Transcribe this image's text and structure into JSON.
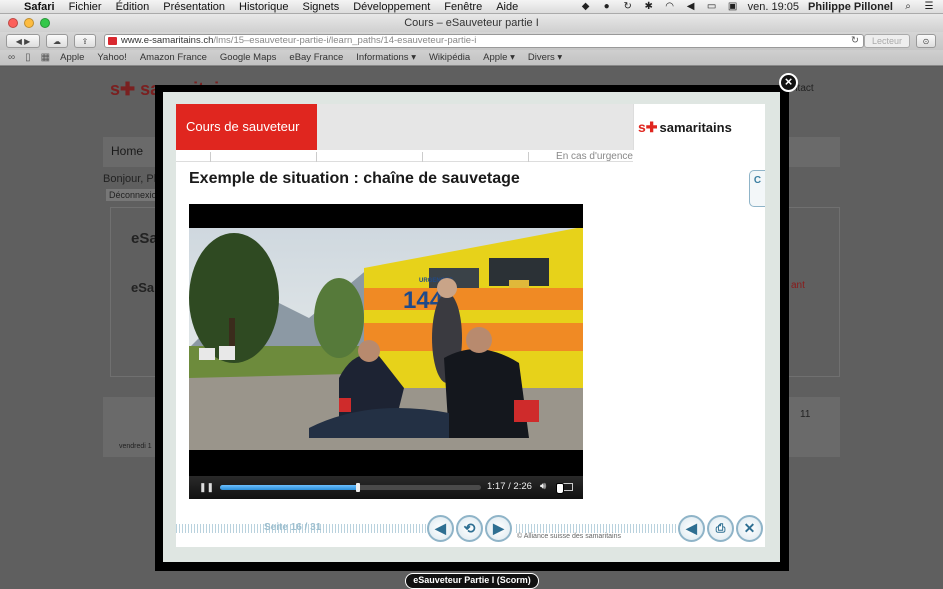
{
  "menubar": {
    "apple": "",
    "items": [
      "Safari",
      "Fichier",
      "Édition",
      "Présentation",
      "Historique",
      "Signets",
      "Développement",
      "Fenêtre",
      "Aide"
    ],
    "clock": "ven. 19:05",
    "user": "Philippe Pillonel"
  },
  "window": {
    "title": "Cours – eSauveteur partie I",
    "url_host": "www.e-samaritains.ch",
    "url_path": "/lms/15–esauveteur-partie-i/learn_paths/14-esauveteur-partie-i",
    "reader_label": "Lecteur"
  },
  "bookmarks": [
    "Apple",
    "Yahoo!",
    "Amazon France",
    "Google Maps",
    "eBay France",
    "Informations ▾",
    "Wikipédia",
    "Apple ▾",
    "Divers ▾"
  ],
  "background_page": {
    "logo": "samaritains",
    "home": "Home",
    "greeting": "Bonjour, Ph",
    "logout": "Déconnexion",
    "section1": "eSa",
    "section2": "eSa",
    "red_text": "ant",
    "footer_left": "vendredi 1",
    "footer_right": "11",
    "contact": "ntact",
    "scorm_tab": "eSauveteur Partie I (Scorm)"
  },
  "module": {
    "header_label": "Cours de sauveteur",
    "urgence": "En cas d'urgence",
    "brand_mark": "s✚",
    "brand_word": "samaritains",
    "title": "Exemple de situation : chaîne de sauvetage",
    "side_tab_icon": "C",
    "page_label": "Seite 16 / 31",
    "copyright": "© Alliance suisse des samaritains",
    "ambulance_number": "144",
    "ambulance_word": "URGENCES"
  },
  "video": {
    "elapsed": "1:17",
    "separator": "/",
    "duration": "2:26",
    "progress": 0.53
  },
  "icons": {
    "close": "close-icon",
    "pause": "pause-icon",
    "volume": "volume-icon",
    "fullscreen": "fullscreen-icon",
    "prev": "chevron-left-icon",
    "replay": "replay-icon",
    "next": "chevron-right-icon",
    "sound": "speaker-icon",
    "print": "print-icon",
    "exit": "close-icon"
  },
  "colors": {
    "brand_red": "#e0261f",
    "accent_blue": "#2e6f92",
    "progress_blue": "#2d8fd9"
  }
}
